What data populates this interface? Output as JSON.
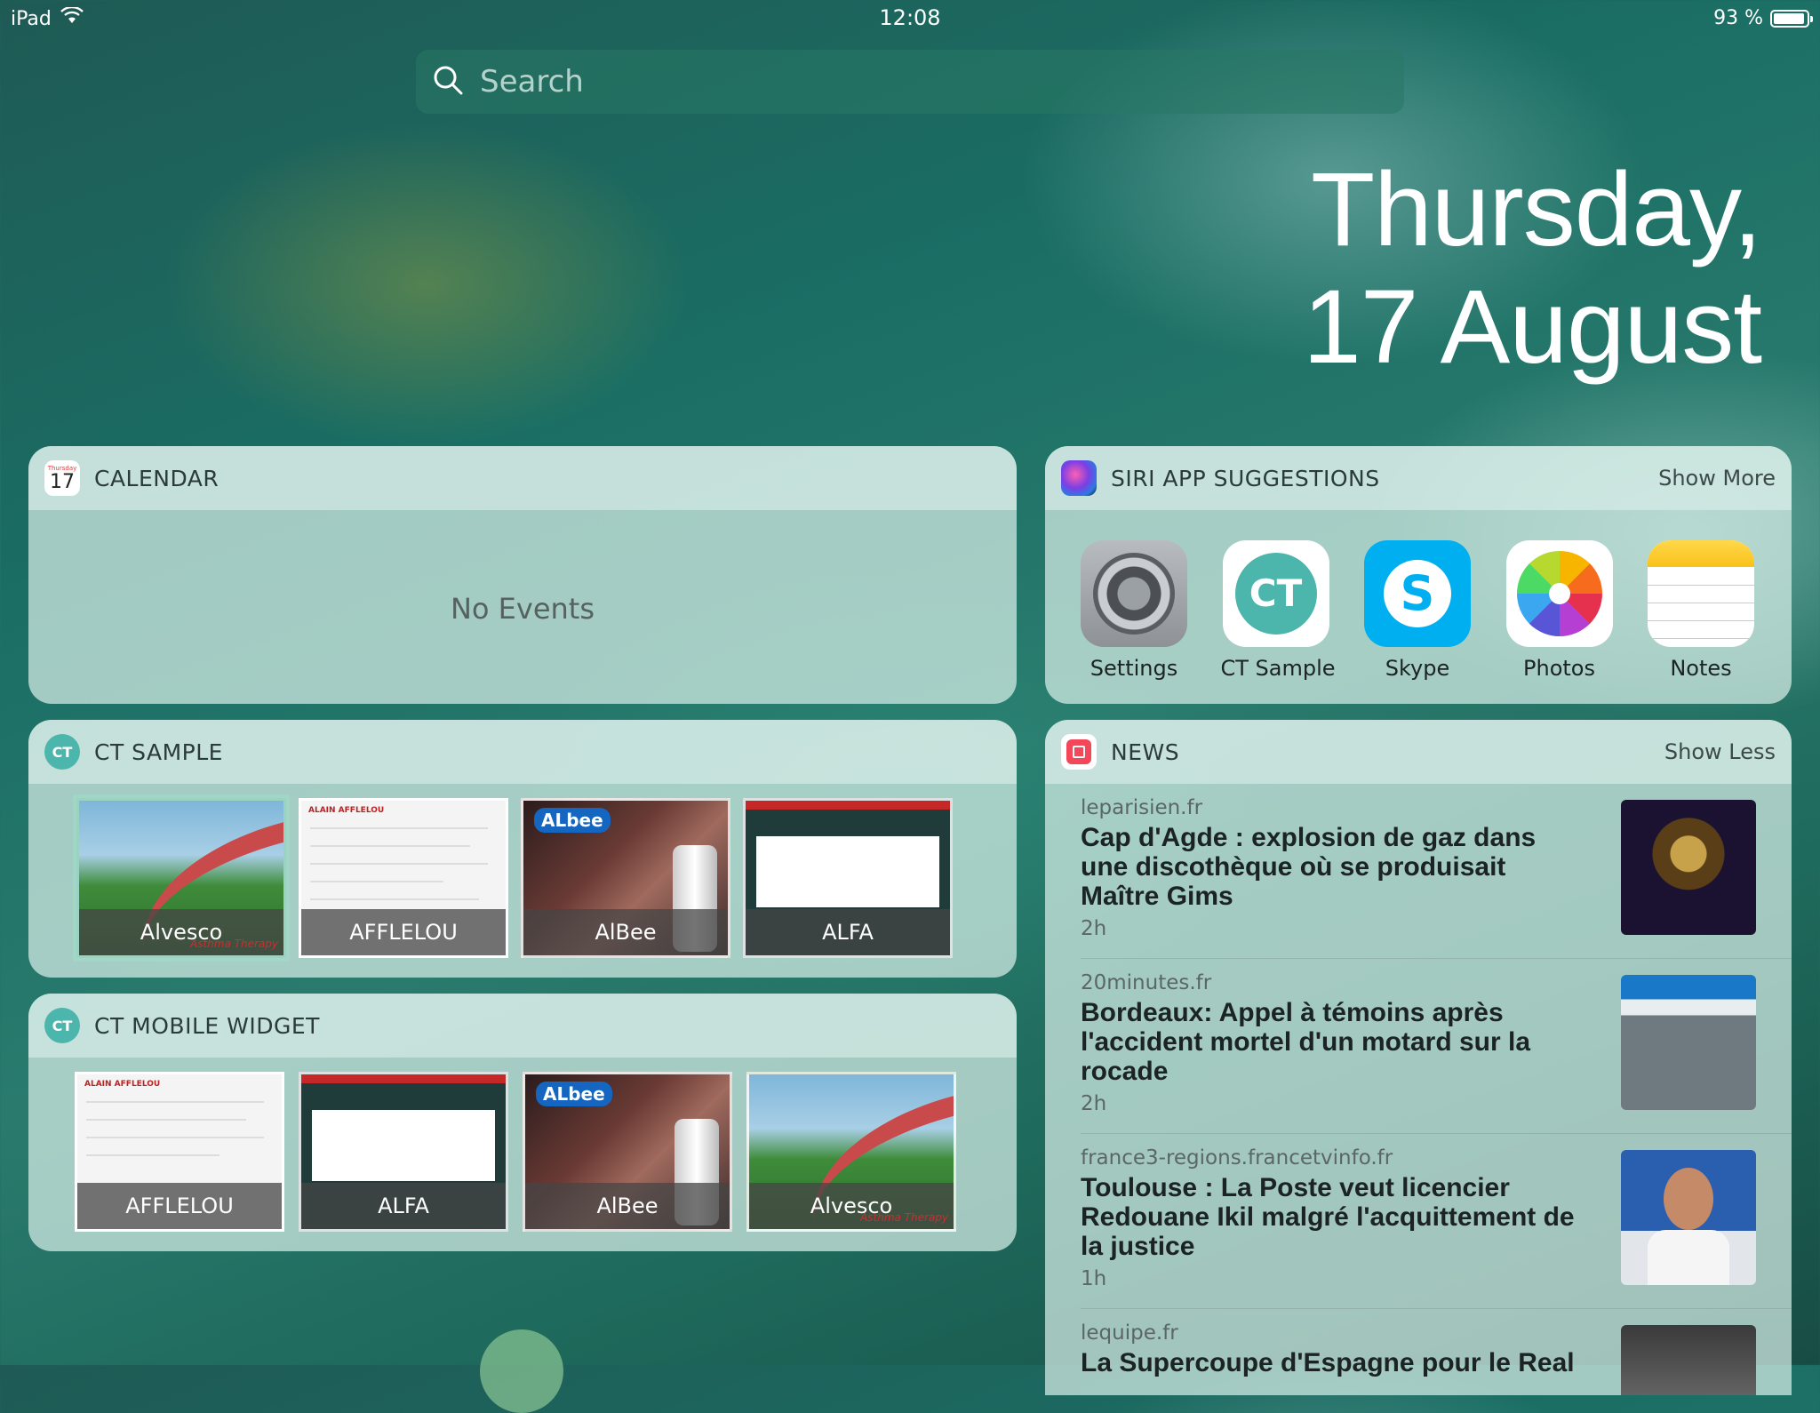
{
  "status_bar": {
    "device": "iPad",
    "time": "12:08",
    "battery_text": "93 %",
    "battery_level": 0.93
  },
  "search": {
    "placeholder": "Search"
  },
  "date": {
    "line1": "Thursday,",
    "line2": "17 August"
  },
  "calendar": {
    "title": "CALENDAR",
    "icon_day_name": "Thursday",
    "icon_day": "17",
    "empty_text": "No Events"
  },
  "ct_sample": {
    "title": "CT SAMPLE",
    "items": [
      {
        "label": "Alvesco",
        "sub": "Asthma Therapy"
      },
      {
        "label": "AFFLELOU"
      },
      {
        "label": "AlBee"
      },
      {
        "label": "ALFA"
      }
    ]
  },
  "ct_mobile_widget": {
    "title": "CT MOBILE WIDGET",
    "items": [
      {
        "label": "AFFLELOU"
      },
      {
        "label": "ALFA"
      },
      {
        "label": "AlBee"
      },
      {
        "label": "Alvesco",
        "sub": "Asthma Therapy"
      }
    ]
  },
  "siri": {
    "title": "SIRI APP SUGGESTIONS",
    "action": "Show More",
    "apps": [
      {
        "label": "Settings",
        "icon": "settings-icon"
      },
      {
        "label": "CT Sample",
        "icon": "ct-sample-icon"
      },
      {
        "label": "Skype",
        "icon": "skype-icon"
      },
      {
        "label": "Photos",
        "icon": "photos-icon"
      },
      {
        "label": "Notes",
        "icon": "notes-icon"
      }
    ]
  },
  "news": {
    "title": "NEWS",
    "action": "Show Less",
    "items": [
      {
        "source": "leparisien.fr",
        "headline": "Cap d'Agde : explosion de gaz dans une discothèque où se produisait Maître Gims",
        "age": "2h"
      },
      {
        "source": "20minutes.fr",
        "headline": "Bordeaux: Appel à témoins après l'accident mortel d'un motard sur la rocade",
        "age": "2h"
      },
      {
        "source": "france3-regions.francetvinfo.fr",
        "headline": "Toulouse : La Poste veut licencier Redouane Ikil malgré l'acquittement de la justice",
        "age": "1h"
      },
      {
        "source": "lequipe.fr",
        "headline": "La Supercoupe d'Espagne pour le Real",
        "age": ""
      }
    ]
  },
  "colors": {
    "accent_teal": "#4db6ac",
    "skype_blue": "#00aff0",
    "news_red": "#f3485a"
  }
}
